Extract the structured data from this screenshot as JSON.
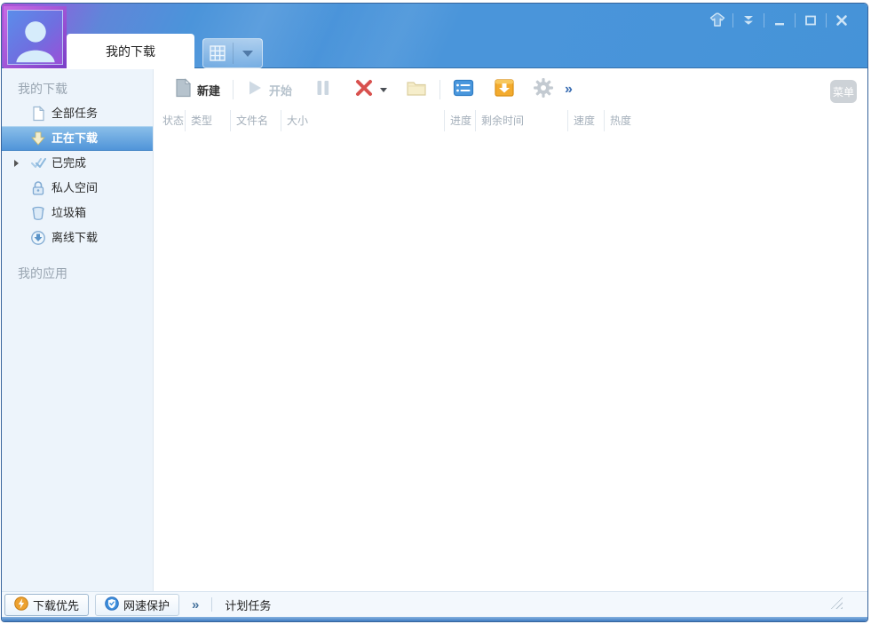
{
  "titlebar": {
    "tab_label": "我的下载"
  },
  "toolbar": {
    "new_label": "新建",
    "start_label": "开始",
    "more_label": "»",
    "menu_button_label": "菜单"
  },
  "list": {
    "columns": [
      "状态",
      "类型",
      "文件名",
      "大小",
      "进度",
      "剩余时间",
      "速度",
      "热度"
    ]
  },
  "sidebar": {
    "section_downloads_title": "我的下载",
    "section_apps_title": "我的应用",
    "items": [
      {
        "label": "全部任务",
        "icon": "document-icon",
        "selected": false
      },
      {
        "label": "正在下载",
        "icon": "download-arrow-icon",
        "selected": true
      },
      {
        "label": "已完成",
        "icon": "double-check-icon",
        "selected": false,
        "expandable": true
      },
      {
        "label": "私人空间",
        "icon": "lock-icon",
        "selected": false
      },
      {
        "label": "垃圾箱",
        "icon": "trash-icon",
        "selected": false
      },
      {
        "label": "离线下载",
        "icon": "offline-download-icon",
        "selected": false
      }
    ]
  },
  "statusbar": {
    "download_priority_label": "下载优先",
    "speed_protect_label": "网速保护",
    "more_label": "»",
    "scheduled_tasks_label": "计划任务"
  },
  "icons": {
    "titlebar": [
      "user-avatar-icon",
      "grid-tabs-icon",
      "dropdown-caret-icon",
      "skin-shirt-icon",
      "collapse-double-chevron-icon",
      "minimize-icon",
      "maximize-icon",
      "close-icon"
    ],
    "toolbar": [
      "new-document-icon",
      "start-play-icon",
      "pause-icon",
      "delete-x-icon",
      "delete-caret-icon",
      "folder-icon",
      "task-panel-icon",
      "download-box-icon",
      "settings-gear-icon",
      "more-chevrons-icon"
    ],
    "statusbar": [
      "lightning-icon",
      "shield-icon",
      "resize-grip"
    ]
  },
  "colors": {
    "header_blue": "#4a95da",
    "header_purple": "#b14fd4",
    "selected_item_blue": "#4e93d8",
    "sidebar_bg": "#edf4fb",
    "accent_orange": "#f3ab2e",
    "danger_red": "#d8514e",
    "statusbar_bg": "#f3f8fd"
  }
}
